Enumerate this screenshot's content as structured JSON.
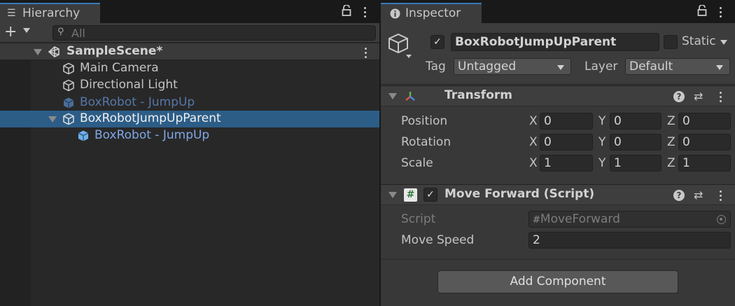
{
  "hierarchy": {
    "tab_label": "Hierarchy",
    "search_placeholder": "All",
    "scene_name": "SampleScene*",
    "items": [
      {
        "label": "Main Camera"
      },
      {
        "label": "Directional Light"
      },
      {
        "label": "BoxRobot - JumpUp"
      },
      {
        "label": "BoxRobotJumpUpParent"
      },
      {
        "label": "BoxRobot - JumpUp"
      }
    ]
  },
  "inspector": {
    "tab_label": "Inspector",
    "object_name": "BoxRobotJumpUpParent",
    "static_label": "Static",
    "tag_label": "Tag",
    "tag_value": "Untagged",
    "layer_label": "Layer",
    "layer_value": "Default",
    "transform": {
      "title": "Transform",
      "position_label": "Position",
      "rotation_label": "Rotation",
      "scale_label": "Scale",
      "position": {
        "x": "0",
        "y": "0",
        "z": "0"
      },
      "rotation": {
        "x": "0",
        "y": "0",
        "z": "0"
      },
      "scale": {
        "x": "1",
        "y": "1",
        "z": "1"
      }
    },
    "axis": {
      "x": "X",
      "y": "Y",
      "z": "Z"
    },
    "move_forward": {
      "title": "Move Forward (Script)",
      "script_label": "Script",
      "script_value": "MoveForward",
      "speed_label": "Move Speed",
      "speed_value": "2"
    },
    "add_component_label": "Add Component"
  },
  "colors": {
    "selection": "#2c5d87",
    "prefab_text": "#7fa8e6",
    "prefab_text_dim": "#5677a8",
    "tab_accent": "#3a79bb"
  }
}
